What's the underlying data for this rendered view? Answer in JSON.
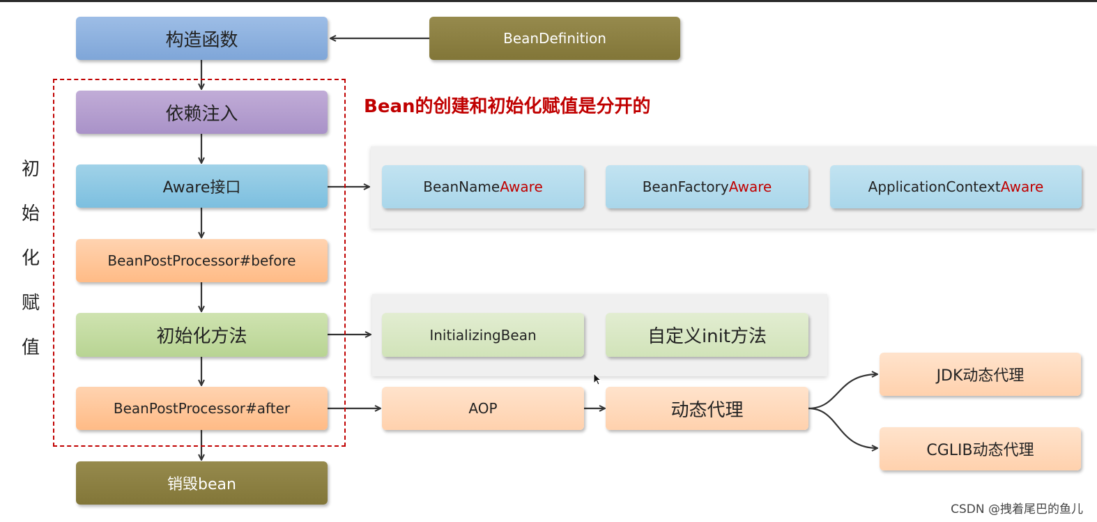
{
  "headline": "Bean的创建和初始化赋值是分开的",
  "side_label": [
    "初",
    "始",
    "化",
    "赋",
    "值"
  ],
  "main_flow": {
    "constructor": "构造函数",
    "dependency_injection": "依赖注入",
    "aware_interface": "Aware接口",
    "bpp_before": "BeanPostProcessor#before",
    "init_method": "初始化方法",
    "bpp_after": "BeanPostProcessor#after",
    "destroy_bean": "销毁bean"
  },
  "bean_definition": "BeanDefinition",
  "aware_items": [
    {
      "prefix": "BeanName",
      "suffix": "Aware"
    },
    {
      "prefix": "BeanFactory",
      "suffix": "Aware"
    },
    {
      "prefix": "ApplicationContext",
      "suffix": "Aware"
    }
  ],
  "init_items": [
    "InitializingBean",
    "自定义init方法"
  ],
  "aop": "AOP",
  "dynamic_proxy": "动态代理",
  "proxy_types": [
    "JDK动态代理",
    "CGLIB动态代理"
  ],
  "watermark": "CSDN @拽着尾巴的鱼儿",
  "colors": {
    "accent_red": "#c00000",
    "blue": "#8fb2df",
    "purple": "#b19dcf",
    "cyan": "#8cc8e3",
    "orange": "#ffc797",
    "green": "#c4dba2",
    "olive": "#8c8042"
  }
}
